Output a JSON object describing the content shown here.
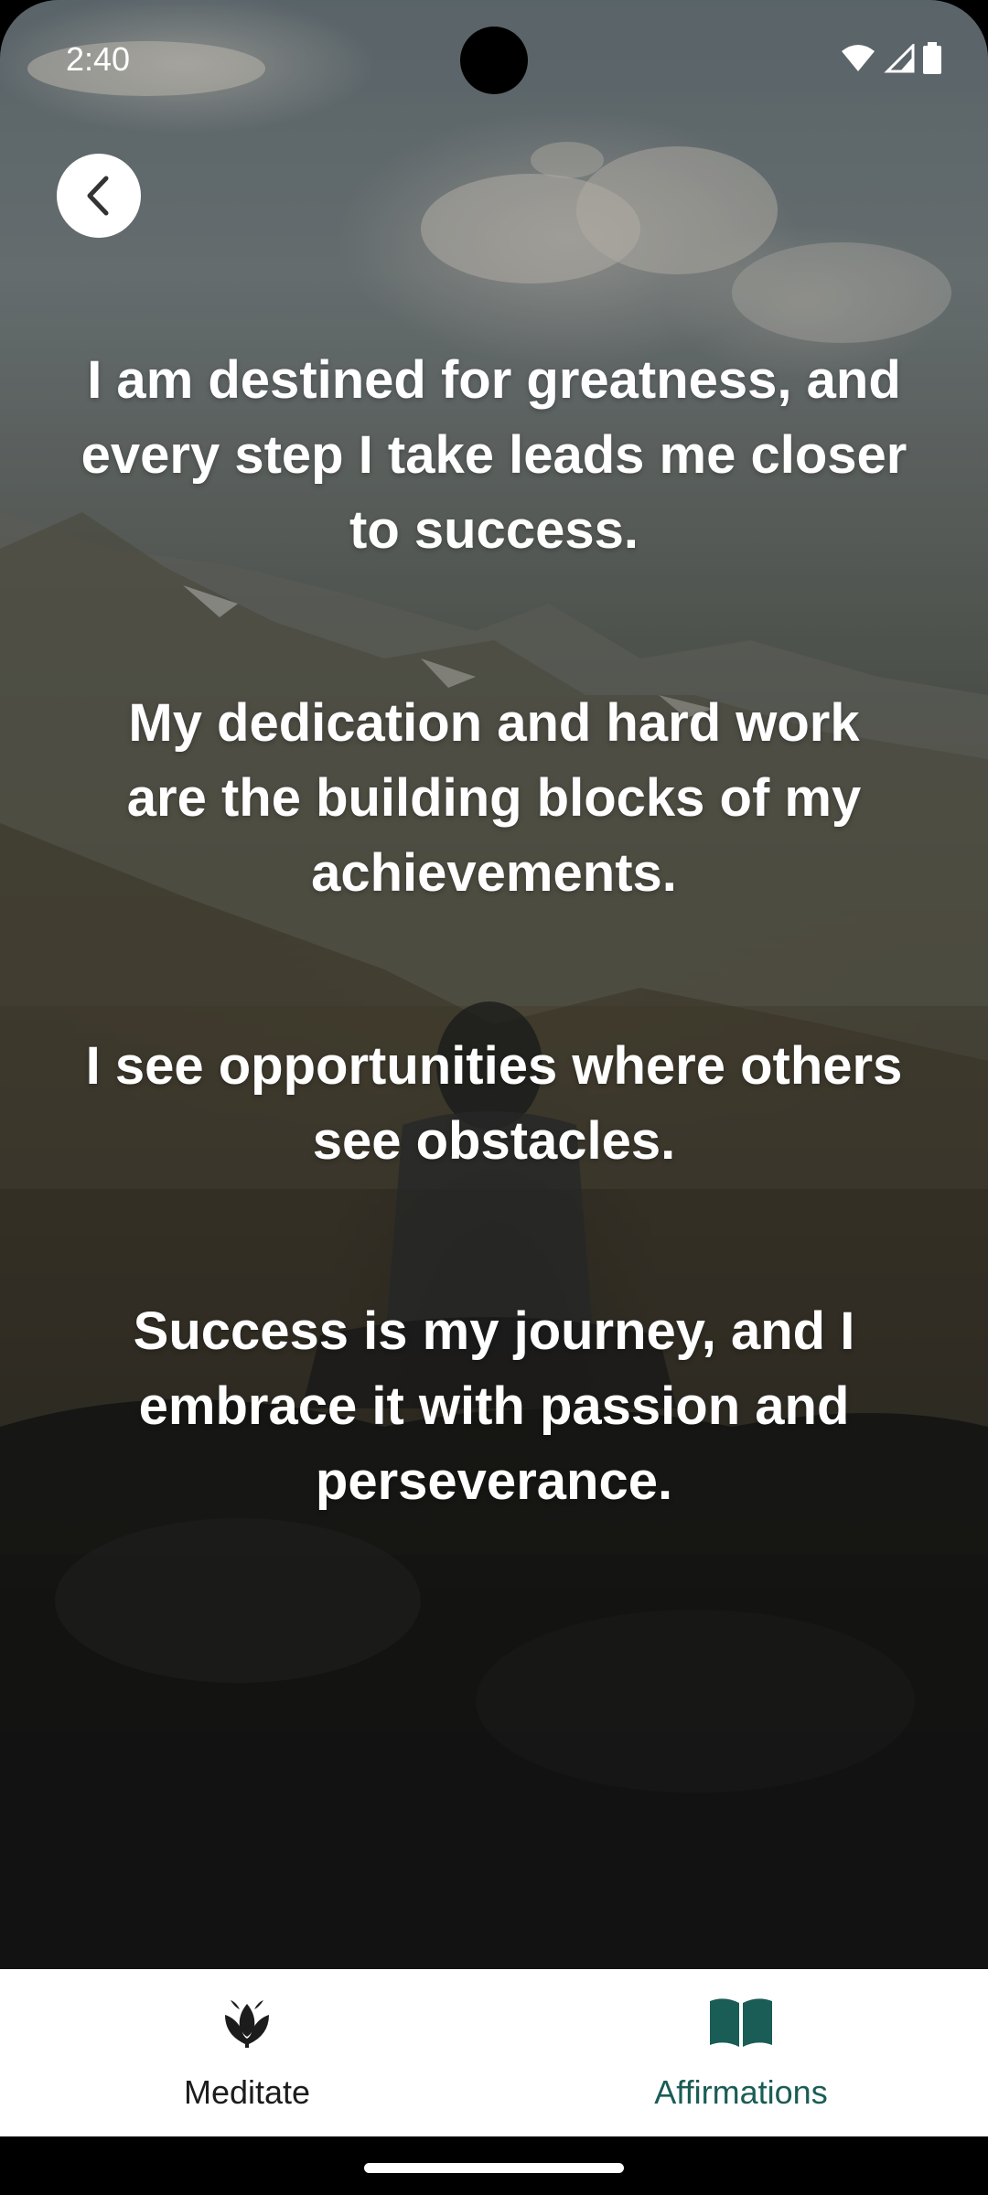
{
  "status_bar": {
    "time": "2:40",
    "icons": [
      "wifi-icon",
      "cellular-signal-icon",
      "battery-icon"
    ]
  },
  "header": {
    "back_icon": "chevron-left-icon"
  },
  "affirmations": [
    "I am destined for greatness, and every step I take leads me closer to success.",
    "My dedication and hard work are the building blocks of my achievements.",
    "I see opportunities where others see obstacles.",
    "Success is my journey, and I embrace it with passion and perseverance."
  ],
  "bottom_nav": {
    "items": [
      {
        "label": "Meditate",
        "icon": "lotus-icon",
        "active": false
      },
      {
        "label": "Affirmations",
        "icon": "open-book-icon",
        "active": true
      }
    ],
    "active_color": "#1a5c56",
    "inactive_color": "#1c1c1c"
  }
}
